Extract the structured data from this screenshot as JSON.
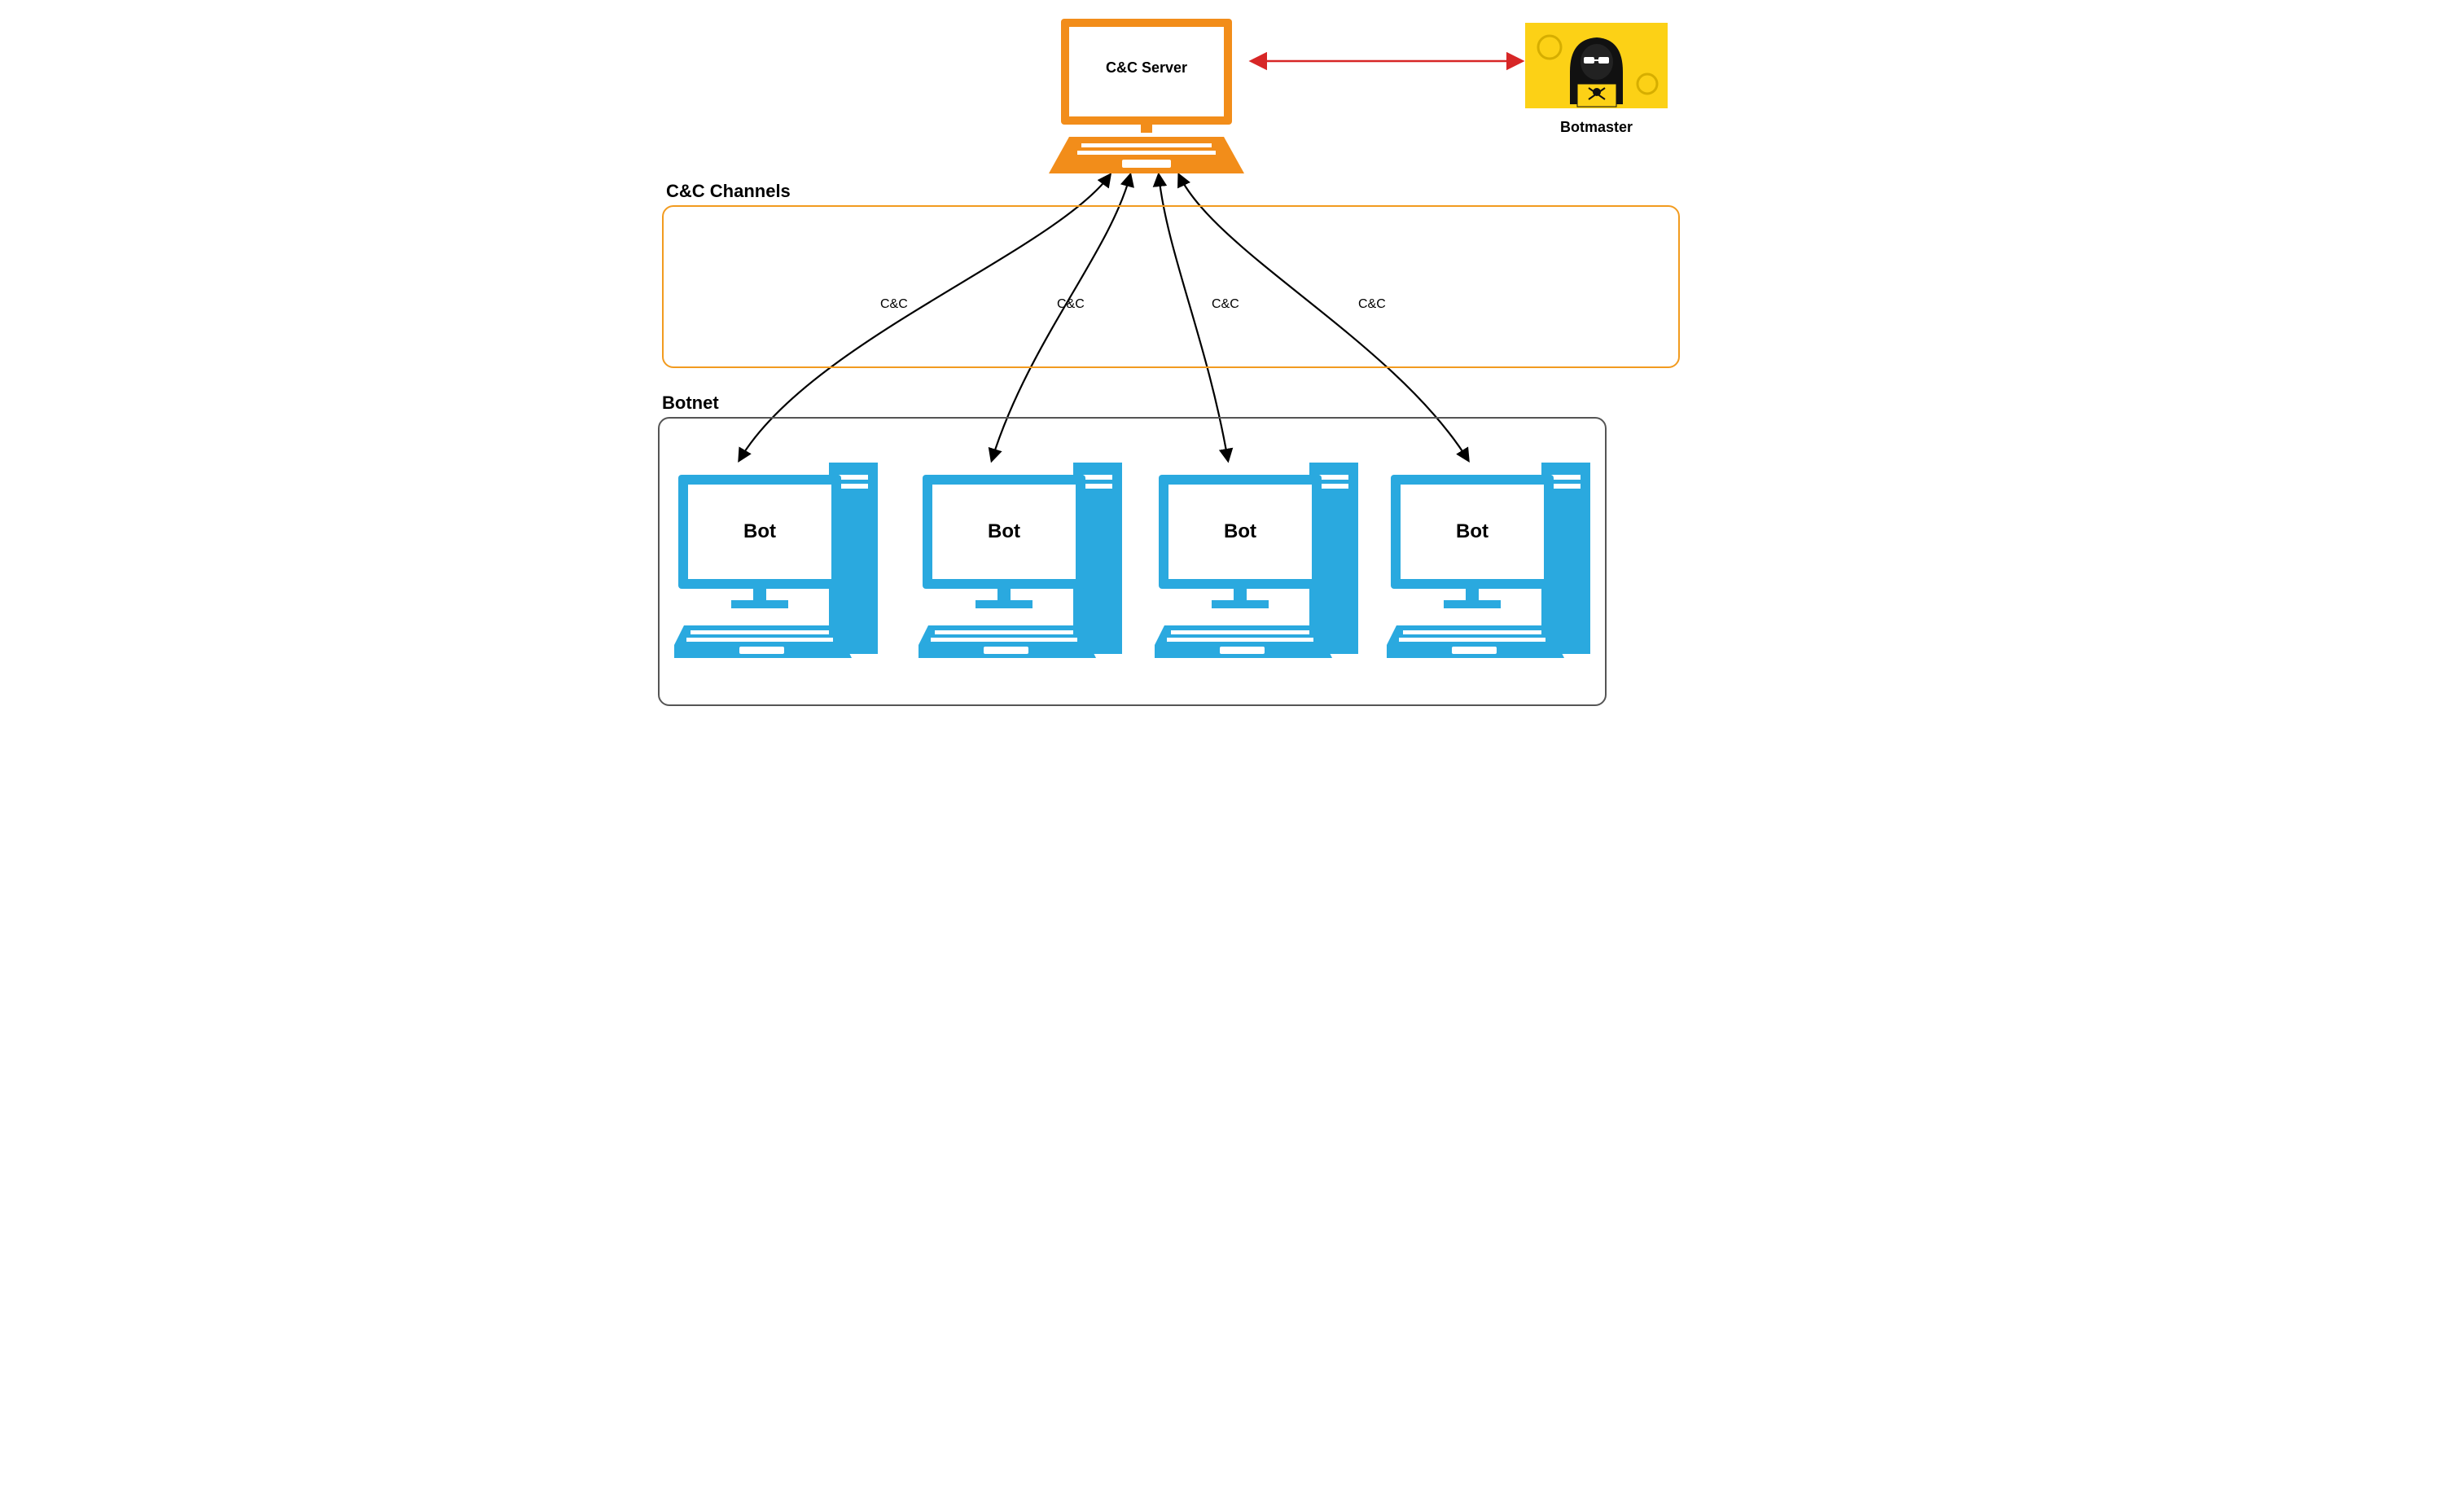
{
  "diagram": {
    "title_channels": "C&C Channels",
    "title_botnet": "Botnet",
    "server_label": "C&C Server",
    "botmaster_label": "Botmaster",
    "channel_label_1": "C&C",
    "channel_label_2": "C&C",
    "channel_label_3": "C&C",
    "channel_label_4": "C&C",
    "bot_label_1": "Bot",
    "bot_label_2": "Bot",
    "bot_label_3": "Bot",
    "bot_label_4": "Bot",
    "colors": {
      "server": "#f28d1a",
      "bot": "#2aa9df",
      "channels_border": "#f29b1f",
      "botnet_border": "#555555",
      "botmaster_bg": "#fcd116",
      "arrow_red": "#d72626",
      "arrow_black": "#000000"
    },
    "structure": {
      "type": "centralized_botnet_topology",
      "server": {
        "role": "C&C Server",
        "count": 1
      },
      "botmaster": {
        "role": "Botmaster",
        "count": 1,
        "link_to": "C&C Server",
        "link_style": "bidirectional_red"
      },
      "channels": {
        "count": 4,
        "label": "C&C",
        "direction": "bidirectional_black_curved"
      },
      "bots": {
        "count": 4,
        "label": "Bot"
      }
    }
  }
}
